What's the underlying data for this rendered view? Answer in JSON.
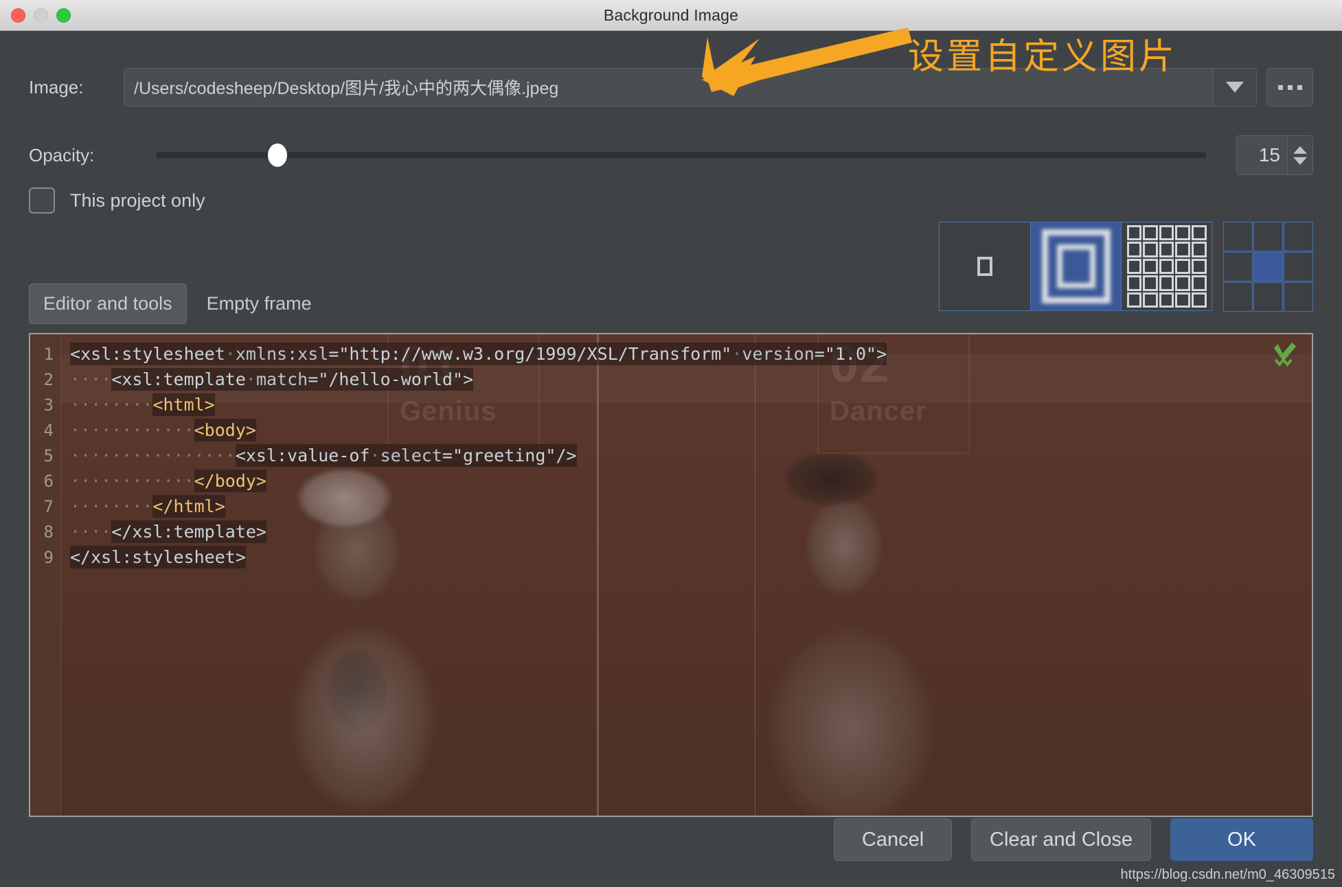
{
  "window": {
    "title": "Background Image",
    "traffic_lights": [
      "close-button",
      "minimize-button",
      "zoom-button"
    ]
  },
  "image_row": {
    "label": "Image:",
    "path_value": "/Users/codesheep/Desktop/图片/我心中的两大偶像.jpeg",
    "dropdown_icon": "chevron-down-icon",
    "browse_label": "..."
  },
  "opacity_row": {
    "label": "Opacity:",
    "value": "15",
    "slider_percent": 11.5
  },
  "project_row": {
    "checkbox_label": "This project only",
    "checked": false
  },
  "tabs": [
    {
      "label": "Editor and tools",
      "selected": true
    },
    {
      "label": "Empty frame",
      "selected": false
    }
  ],
  "placement": {
    "fill_modes": [
      {
        "name": "plain-center",
        "selected": false
      },
      {
        "name": "scale-to-fit",
        "selected": true
      },
      {
        "name": "tile",
        "selected": false
      }
    ],
    "anchor_grid": {
      "selected_index": 4,
      "cells": 9
    }
  },
  "editor": {
    "inspection_icon": "green-check-icon",
    "lines": [
      {
        "n": "1",
        "html": "<span class=\"seg\"><span class=\"tok-punct\">&lt;</span><span class=\"tok-punct\">xsl:stylesheet</span><span class=\"tok-dot\">·</span><span class=\"tok-attr\">xmlns:xsl</span><span class=\"tok-punct\">=</span><span class=\"tok-str\">\"http://www.w3.org/1999/XSL/Transform\"</span><span class=\"tok-dot\">·</span><span class=\"tok-attr\">version</span><span class=\"tok-punct\">=</span><span class=\"tok-str\">\"1.0\"</span><span class=\"tok-punct\">&gt;</span></span>"
      },
      {
        "n": "2",
        "html": "<span class=\"tok-dot\">····</span><span class=\"seg\"><span class=\"tok-punct\">&lt;xsl:template</span><span class=\"tok-dot\">·</span><span class=\"tok-attr\">match</span><span class=\"tok-punct\">=</span><span class=\"tok-str\">\"/hello-world\"</span><span class=\"tok-punct\">&gt;</span></span>"
      },
      {
        "n": "3",
        "html": "<span class=\"tok-dot\">········</span><span class=\"seg tok-tag\">&lt;html&gt;</span>"
      },
      {
        "n": "4",
        "html": "<span class=\"tok-dot\">············</span><span class=\"seg tok-tag\">&lt;body&gt;</span>"
      },
      {
        "n": "5",
        "html": "<span class=\"tok-dot\">················</span><span class=\"seg\"><span class=\"tok-punct\">&lt;xsl:value-of</span><span class=\"tok-dot\">·</span><span class=\"tok-attr\">select</span><span class=\"tok-punct\">=</span><span class=\"tok-str\">\"greeting\"</span><span class=\"tok-punct\">/&gt;</span></span>"
      },
      {
        "n": "6",
        "html": "<span class=\"tok-dot\">············</span><span class=\"seg tok-tag\">&lt;/body&gt;</span>"
      },
      {
        "n": "7",
        "html": "<span class=\"tok-dot\">········</span><span class=\"seg tok-tag\">&lt;/html&gt;</span>"
      },
      {
        "n": "8",
        "html": "<span class=\"tok-dot\">····</span><span class=\"seg\"><span class=\"tok-punct\">&lt;/xsl:template&gt;</span></span>"
      },
      {
        "n": "9",
        "html": "<span class=\"seg\"><span class=\"tok-punct\">&lt;/xsl:stylesheet&gt;</span></span>"
      }
    ],
    "background_photo": {
      "left_caption_number": "01",
      "left_caption_word": "Genius",
      "right_caption_number": "02",
      "right_caption_word": "Dancer"
    }
  },
  "footer": {
    "buttons": [
      {
        "label": "Cancel",
        "primary": false
      },
      {
        "label": "Clear and Close",
        "primary": false
      },
      {
        "label": "OK",
        "primary": true
      }
    ]
  },
  "annotation": {
    "text": "设置自定义图片",
    "color": "#f5a623",
    "arrow": "arrow-pointing-left-down"
  },
  "watermark": {
    "text": "https://blog.csdn.net/m0_46309515"
  },
  "colors": {
    "dialog_background": "#3f4346",
    "titlebar": "#dcdcdc",
    "accent_blue": "#3c6298",
    "selection_blue": "#3b5998",
    "annotation_orange": "#f5a623",
    "editor_overlay_brown": "#55342a"
  }
}
